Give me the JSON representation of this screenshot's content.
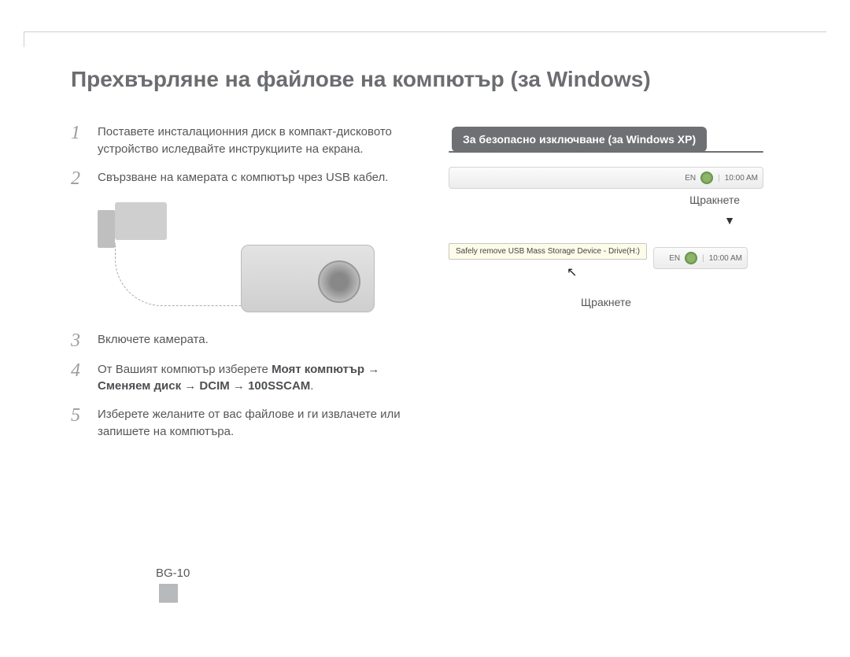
{
  "title": "Прехвърляне на файлове на компютър (за Windows)",
  "steps": {
    "s1": {
      "num": "1",
      "text": "Поставете инсталационния диск в компакт-дисковото устройство иследвайте инструкциите на екрана."
    },
    "s2": {
      "num": "2",
      "text": "Свързване на камерата с компютър чрез USB кабел."
    },
    "s3": {
      "num": "3",
      "text": "Включете камерата."
    },
    "s4": {
      "num": "4",
      "lead": "От Вашият компютър изберете ",
      "bold": "Моят компютър → Сменяем диск → DCIM → 100SSCAM",
      "tail": "."
    },
    "s5": {
      "num": "5",
      "text": "Изберете желаните от вас файлове и ги извлачете или запишете на компютъра."
    }
  },
  "callout": "За безопасно изключване (за Windows XP)",
  "tray": {
    "lang": "EN",
    "time": "10:00 AM"
  },
  "captions": {
    "click1": "Щракнете",
    "click2": "Щракнете"
  },
  "arrow": "▼",
  "popup": "Safely remove USB Mass Storage Device - Drive(H:)",
  "page": "BG-10"
}
